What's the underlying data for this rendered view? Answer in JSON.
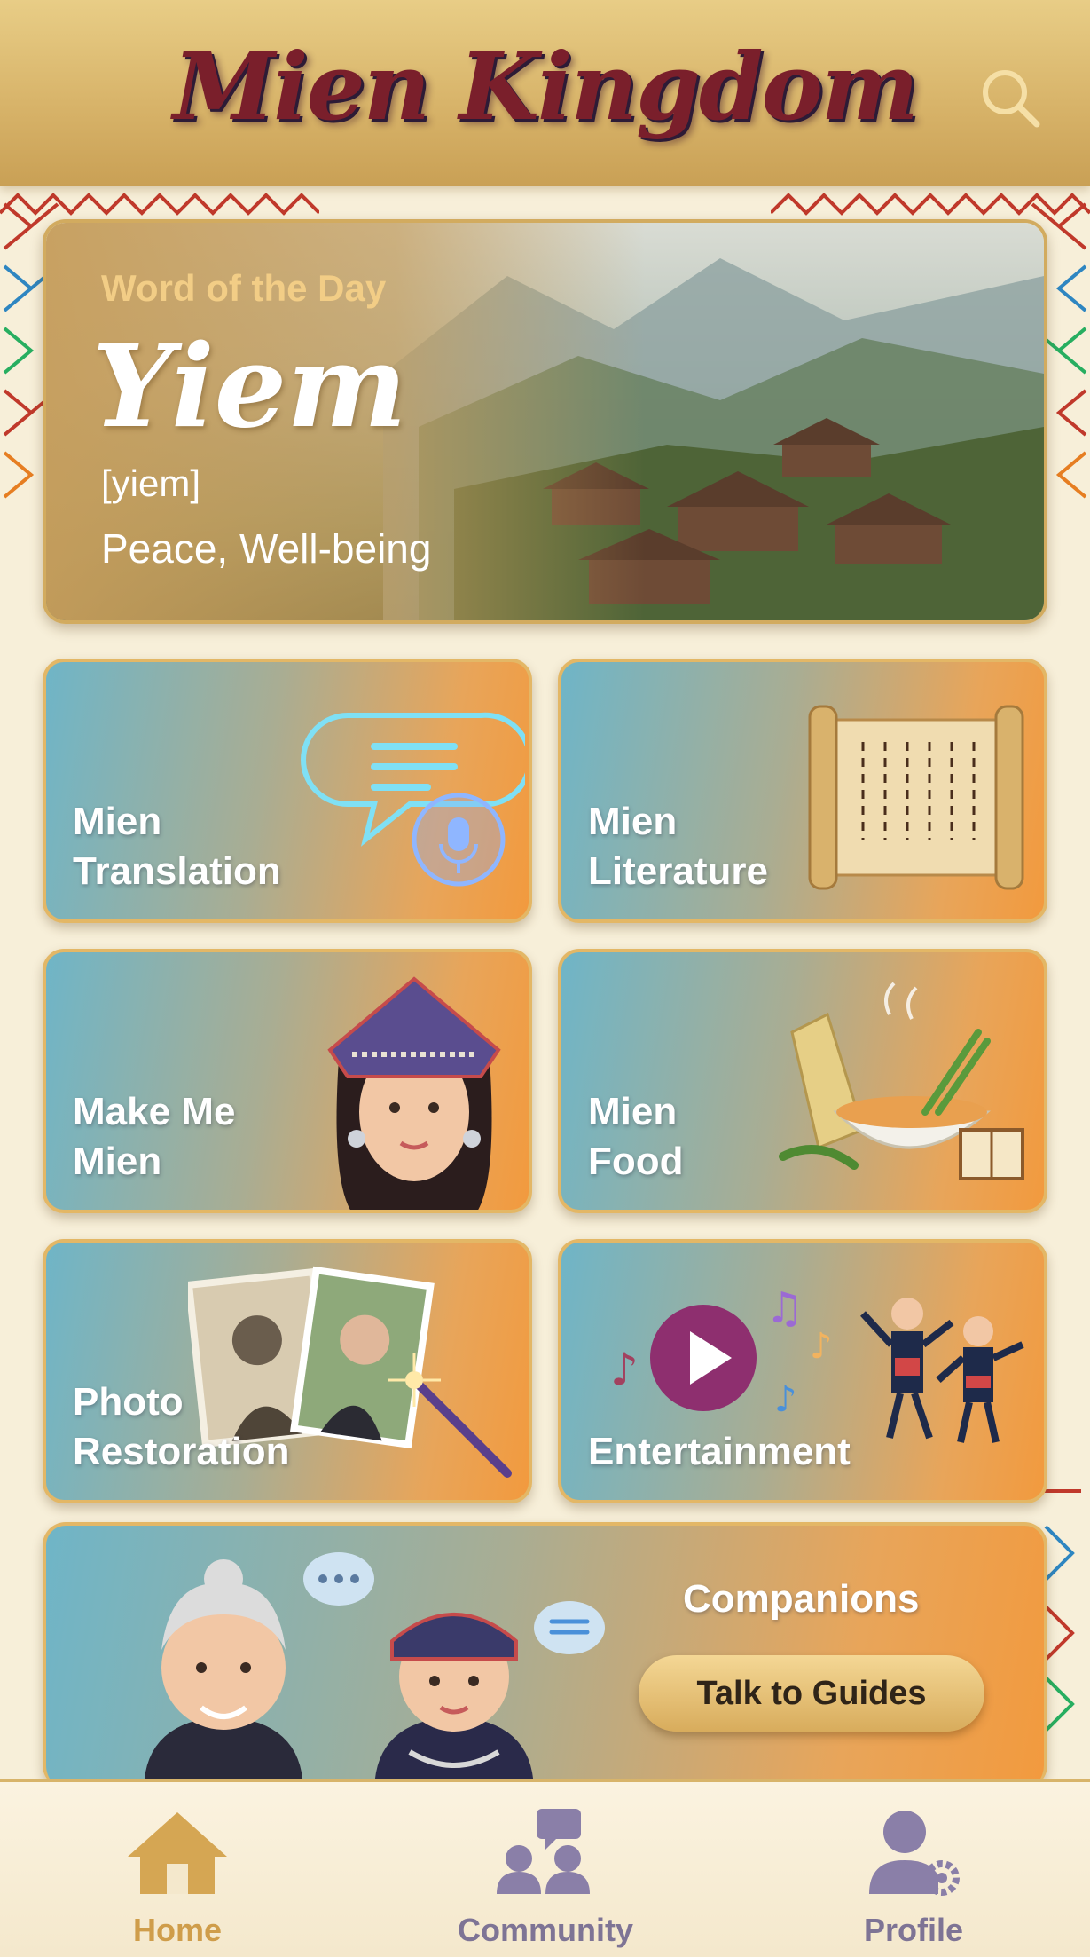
{
  "app": {
    "title": "Mien Kingdom"
  },
  "word_of_the_day": {
    "label": "Word of the Day",
    "word": "Yiem",
    "phonetic": "[yiem]",
    "meaning": "Peace, Well-being"
  },
  "features": [
    {
      "line1": "Mien",
      "line2": "Translation",
      "icon": "speech-bubble-microphone-icon"
    },
    {
      "line1": "Mien",
      "line2": "Literature",
      "icon": "scroll-icon"
    },
    {
      "line1": "Make Me",
      "line2": "Mien",
      "icon": "mien-woman-portrait"
    },
    {
      "line1": "Mien",
      "line2": "Food",
      "icon": "soup-bowl-icon"
    },
    {
      "line1": "Photo",
      "line2": "Restoration",
      "icon": "photo-magic-wand-icon"
    },
    {
      "line1": "",
      "line2": "Entertainment",
      "icon": "play-music-dancers-icon"
    }
  ],
  "companions": {
    "title": "Companions",
    "button_label": "Talk to Guides"
  },
  "nav": [
    {
      "label": "Home",
      "icon": "home-icon",
      "active": true
    },
    {
      "label": "Community",
      "icon": "community-icon",
      "active": false
    },
    {
      "label": "Profile",
      "icon": "profile-settings-icon",
      "active": false
    }
  ],
  "colors": {
    "header_gold": "#d8b46a",
    "accent_orange": "#f29a3e",
    "accent_teal": "#6fb5c7",
    "logo_red": "#7a1f2b",
    "nav_active": "#cf9d4a",
    "nav_inactive": "#7e7495"
  }
}
